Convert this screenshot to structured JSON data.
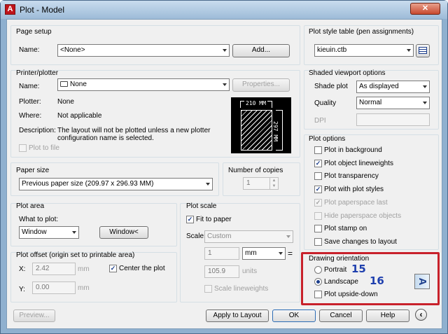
{
  "window": {
    "title": "Plot - Model",
    "app_icon": "A",
    "close": "✕"
  },
  "page_setup": {
    "title": "Page setup",
    "name_label": "Name:",
    "name_value": "<None>",
    "add_button": "Add..."
  },
  "printer": {
    "title": "Printer/plotter",
    "name_label": "Name:",
    "name_value": "None",
    "properties_button": "Properties...",
    "plotter_label": "Plotter:",
    "plotter_value": "None",
    "where_label": "Where:",
    "where_value": "Not applicable",
    "description_label": "Description:",
    "description_value_1": "The layout will not be plotted unless a new plotter",
    "description_value_2": "configuration name is selected.",
    "plot_to_file": "Plot to file",
    "preview_width": "210 MM",
    "preview_height": "297 MM"
  },
  "paper_size": {
    "title": "Paper size",
    "value": "Previous paper size (209.97 x 296.93 MM)"
  },
  "copies": {
    "title": "Number of copies",
    "value": "1"
  },
  "plot_area": {
    "title": "Plot area",
    "what_label": "What to plot:",
    "what_value": "Window",
    "window_button": "Window<"
  },
  "plot_offset": {
    "title": "Plot offset (origin set to printable area)",
    "x_label": "X:",
    "x_value": "2.42",
    "y_label": "Y:",
    "y_value": "0.00",
    "unit": "mm",
    "center_label": "Center the plot",
    "center_checked": true
  },
  "plot_scale": {
    "title": "Plot scale",
    "fit_label": "Fit to paper",
    "fit_checked": true,
    "scale_label": "Scale:",
    "scale_value": "Custom",
    "value1": "1",
    "unit_value": "mm",
    "equals": "=",
    "value2": "105.9",
    "units_label": "units",
    "scale_lineweights": "Scale lineweights"
  },
  "plot_style_table": {
    "title": "Plot style table (pen assignments)",
    "value": "kieuin.ctb"
  },
  "shaded": {
    "title": "Shaded viewport options",
    "shade_label": "Shade plot",
    "shade_value": "As displayed",
    "quality_label": "Quality",
    "quality_value": "Normal",
    "dpi_label": "DPI"
  },
  "plot_options": {
    "title": "Plot options",
    "items": [
      {
        "label": "Plot in background",
        "checked": false,
        "enabled": true
      },
      {
        "label": "Plot object lineweights",
        "checked": true,
        "enabled": true
      },
      {
        "label": "Plot transparency",
        "checked": false,
        "enabled": true
      },
      {
        "label": "Plot with plot styles",
        "checked": true,
        "enabled": true
      },
      {
        "label": "Plot paperspace last",
        "checked": true,
        "enabled": false
      },
      {
        "label": "Hide paperspace objects",
        "checked": false,
        "enabled": false
      },
      {
        "label": "Plot stamp on",
        "checked": false,
        "enabled": true
      },
      {
        "label": "Save changes to layout",
        "checked": false,
        "enabled": true
      }
    ]
  },
  "orientation": {
    "title": "Drawing orientation",
    "portrait": "Portrait",
    "landscape": "Landscape",
    "selected": "landscape",
    "upside_down": "Plot upside-down",
    "preview_glyph": "A"
  },
  "annotations": {
    "step_portrait": "15",
    "step_landscape": "16"
  },
  "footer": {
    "preview": "Preview...",
    "apply": "Apply to Layout",
    "ok": "OK",
    "cancel": "Cancel",
    "help": "Help",
    "expand": "‹"
  },
  "colors": {
    "highlight": "#c8212b",
    "step_text": "#1e3fae",
    "title_bar": "#9dbbd8"
  }
}
